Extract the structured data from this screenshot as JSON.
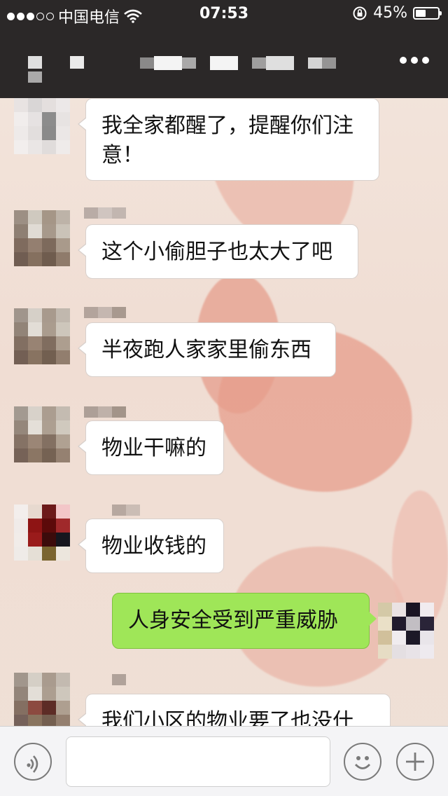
{
  "status_bar": {
    "carrier": "中国电信",
    "time": "07:53",
    "battery": "45%",
    "battery_level": 0.45,
    "signal_bars_filled": 3,
    "signal_bars_total": 5,
    "icons": [
      "wifi-icon",
      "rotation-lock-icon",
      "battery-icon"
    ]
  },
  "nav_bar": {
    "more_icon": "more-dots-icon"
  },
  "messages": [
    {
      "side": "left",
      "text": "我全家都醒了，提醒你们注意！"
    },
    {
      "side": "left",
      "text": "这个小偷胆子也太大了吧"
    },
    {
      "side": "left",
      "text": "半夜跑人家家里偷东西"
    },
    {
      "side": "left",
      "text": "物业干嘛的"
    },
    {
      "side": "left",
      "text": "物业收钱的"
    },
    {
      "side": "right",
      "text": "人身安全受到严重威胁"
    },
    {
      "side": "left",
      "text": "我们小区的物业要了也没什"
    }
  ],
  "input_bar": {
    "text_value": "",
    "icons": [
      "voice-icon",
      "emoji-icon",
      "plus-icon"
    ]
  },
  "colors": {
    "bar_dark": "#2b2828",
    "bubble_green": "#9fe658",
    "bubble_white": "#ffffff"
  }
}
